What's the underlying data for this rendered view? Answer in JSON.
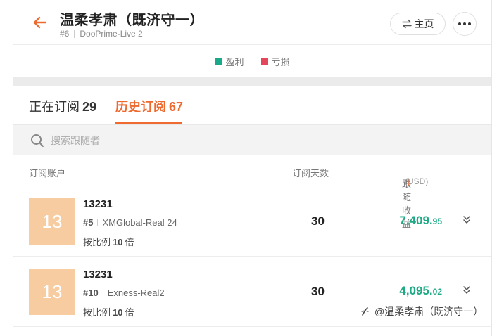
{
  "header": {
    "title": "温柔孝肃（既济守一）",
    "rank": "#6",
    "account": "DooPrime-Live 2",
    "home_label": "主页"
  },
  "legend": {
    "profit_label": "盈利",
    "profit_color": "#18a98b",
    "loss_label": "亏损",
    "loss_color": "#e5475a"
  },
  "tabs": [
    {
      "label": "正在订阅",
      "count": "29"
    },
    {
      "label": "历史订阅",
      "count": "67"
    }
  ],
  "search": {
    "placeholder": "搜索跟随者"
  },
  "columns": {
    "account": "订阅账户",
    "days": "订阅天数",
    "profit": "跟随收益",
    "profit_unit": "(USD)",
    "sort_arrow": "↓"
  },
  "rows": [
    {
      "avatar": "13",
      "name": "13231",
      "rank": "#5",
      "broker": "XMGlobal-Real 24",
      "ratio_prefix": "按比例",
      "ratio_value": "10",
      "ratio_suffix": "倍",
      "days": "30",
      "profit_int": "7,409.",
      "profit_dec": "95"
    },
    {
      "avatar": "13",
      "name": "13231",
      "rank": "#10",
      "broker": "Exness-Real2",
      "ratio_prefix": "按比例",
      "ratio_value": "10",
      "ratio_suffix": "倍",
      "days": "30",
      "profit_int": "4,095.",
      "profit_dec": "02"
    }
  ],
  "watermark": {
    "text": "@温柔孝肃（既济守一）"
  },
  "icons": {
    "back": "arrow-left-icon",
    "home": "swap-icon",
    "more": "more-dots-icon",
    "search": "search-icon",
    "expand": "chevron-double-down-icon"
  }
}
